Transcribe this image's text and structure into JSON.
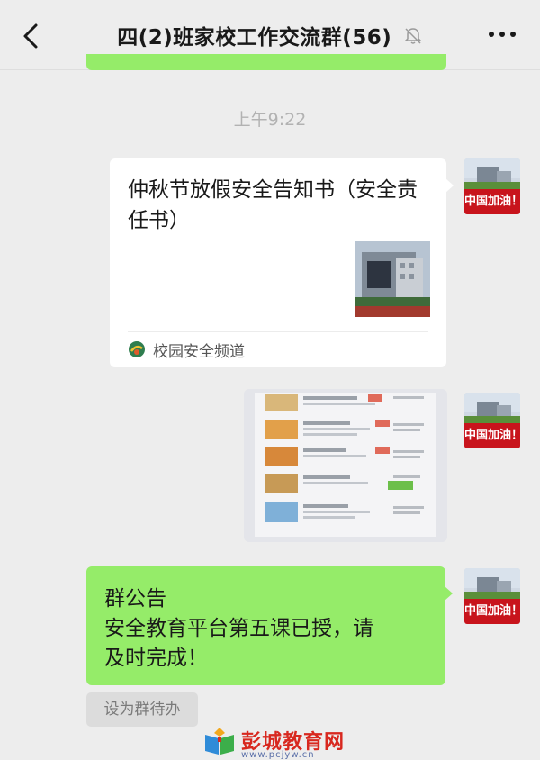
{
  "header": {
    "title": "四(2)班家校工作交流群(56)",
    "back_icon": "chevron-left-icon",
    "mute_icon": "bell-off-icon",
    "more_icon": "more-dots-icon"
  },
  "timestamp": "上午9:22",
  "messages": [
    {
      "type": "link-card",
      "title": "仲秋节放假安全告知书（安全责任书）",
      "source": "校园安全频道",
      "avatar_caption": "中国加油！"
    },
    {
      "type": "image",
      "avatar_caption": "中国加油！"
    },
    {
      "type": "notice",
      "label": "群公告",
      "text_line1": "安全教育平台第五课已授，请",
      "text_line2": "及时完成！",
      "avatar_caption": "中国加油！"
    }
  ],
  "todo_action": "设为群待办",
  "watermark": {
    "name": "彭城教育网",
    "url": "www.pcjyw.cn"
  },
  "colors": {
    "background": "#ededed",
    "own_bubble": "#95ec69",
    "card_bubble": "#ffffff",
    "avatar_band": "#c8141c",
    "watermark_red": "#d8281f"
  }
}
